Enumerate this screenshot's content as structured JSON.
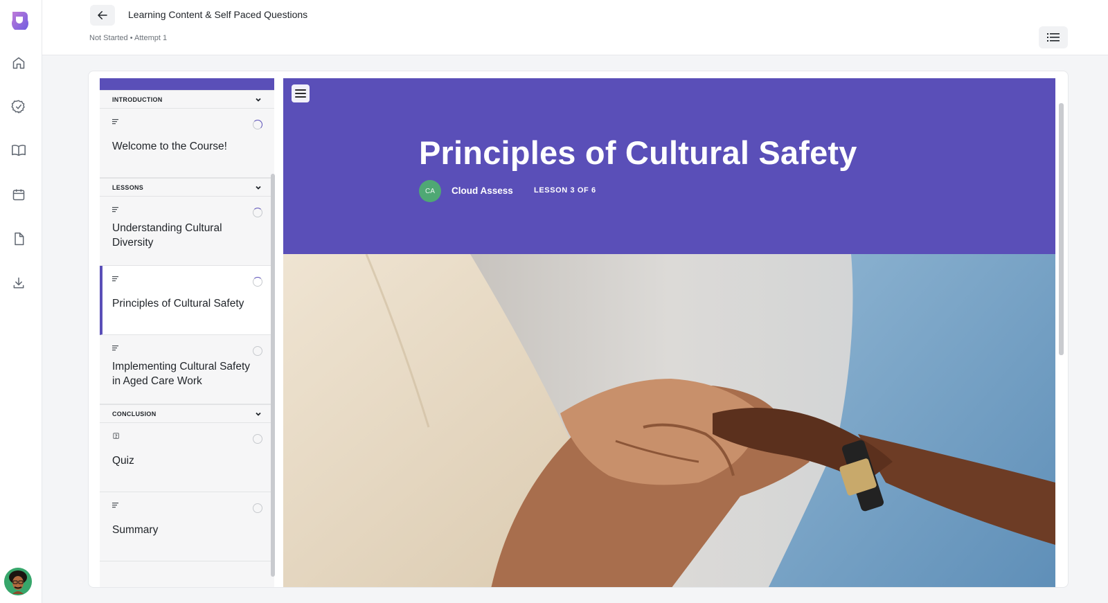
{
  "header": {
    "title": "Learning Content & Self Paced Questions",
    "subtitle": "Not Started • Attempt 1"
  },
  "rail": {
    "items": [
      "home-icon",
      "check-circle-icon",
      "book-icon",
      "calendar-icon",
      "file-icon",
      "download-icon"
    ]
  },
  "outline": {
    "sections": [
      {
        "label": "INTRODUCTION",
        "items": [
          {
            "title": "Welcome to the Course!",
            "icon": "text-lines-icon",
            "status": "in-progress"
          }
        ]
      },
      {
        "label": "LESSONS",
        "items": [
          {
            "title": "Understanding Cultural Diversity",
            "icon": "text-lines-icon",
            "status": "in-progress"
          },
          {
            "title": "Principles of Cultural Safety",
            "icon": "text-lines-icon",
            "status": "in-progress",
            "active": true
          },
          {
            "title": "Implementing Cultural Safety in Aged Care Work",
            "icon": "text-lines-icon",
            "status": "not-started"
          }
        ]
      },
      {
        "label": "CONCLUSION",
        "items": [
          {
            "title": "Quiz",
            "icon": "question-icon",
            "status": "not-started"
          },
          {
            "title": "Summary",
            "icon": "text-lines-icon",
            "status": "not-started"
          }
        ]
      }
    ]
  },
  "lesson": {
    "title": "Principles of Cultural Safety",
    "author_initials": "CA",
    "author": "Cloud Assess",
    "lesson_count": "LESSON 3 OF 6"
  },
  "colors": {
    "accent": "#5a4fb8",
    "author_avatar": "#4fa874"
  }
}
